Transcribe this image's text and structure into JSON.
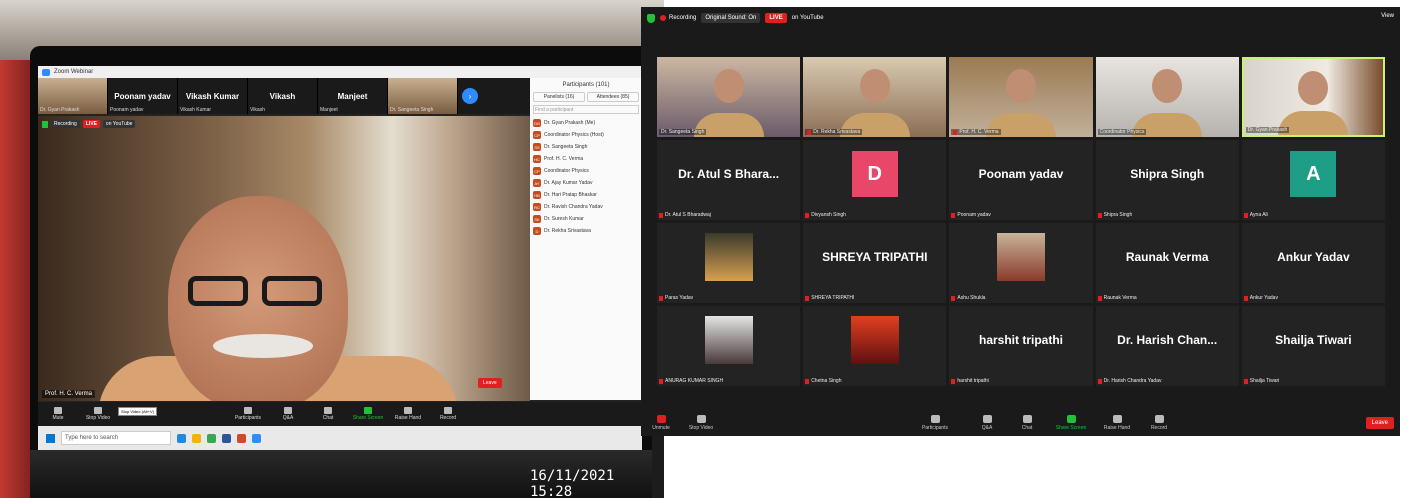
{
  "left_photo": {
    "window_title": "Zoom Webinar",
    "strip": [
      {
        "name": "",
        "sub": "Dr. Gyan Prakash",
        "video": true
      },
      {
        "name": "Poonam yadav",
        "sub": "Poonam yadav",
        "video": false
      },
      {
        "name": "Vikash Kumar",
        "sub": "Vikash Kumar",
        "video": false
      },
      {
        "name": "Vikash",
        "sub": "Vikash",
        "video": false
      },
      {
        "name": "Manjeet",
        "sub": "Manjeet",
        "video": false
      },
      {
        "name": "",
        "sub": "Dr. Sangeeta Singh",
        "video": true
      }
    ],
    "recording": "Recording",
    "live": "LIVE",
    "on_youtube": "on YouTube",
    "active_speaker": "Prof. H. C. Verma",
    "leave": "Leave",
    "panel": {
      "title": "Participants (101)",
      "tab_panelists": "Panelists (16)",
      "tab_attendees": "Attendees (85)",
      "find_placeholder": "Find a participant",
      "rows": [
        {
          "initials": "DG",
          "name": "Dr. Gyan Prakash (Me)"
        },
        {
          "initials": "CP",
          "name": "Coordinator Physics (Host)"
        },
        {
          "initials": "SS",
          "name": "Dr. Sangeeta Singh"
        },
        {
          "initials": "HC",
          "name": "Prof. H. C. Verma"
        },
        {
          "initials": "CP",
          "name": "Coordinator Physics"
        },
        {
          "initials": "AY",
          "name": "Dr. Ajay Kumar Yadav"
        },
        {
          "initials": "HB",
          "name": "Dr. Hari Pratap Bhaskar"
        },
        {
          "initials": "RC",
          "name": "Dr. Ravish Chandra Yadav"
        },
        {
          "initials": "SK",
          "name": "Dr. Suresh Kumar"
        },
        {
          "initials": "D",
          "name": "Dr. Rekha Srivastava"
        }
      ]
    },
    "controls": {
      "mute": "Mute",
      "stop_video": "Stop Video",
      "participants": "Participants",
      "participants_count": "101",
      "qa": "Q&A",
      "chat": "Chat",
      "share": "Share Screen",
      "raise": "Raise Hand",
      "record": "Record",
      "tooltip": "Stop Video (Alt+V)"
    },
    "taskbar_search": "Type here to search",
    "timestamp": "16/11/2021 15:28"
  },
  "zoom": {
    "recording": "Recording",
    "original_sound": "Original Sound: On",
    "live": "LIVE",
    "on_youtube": "on YouTube",
    "view": "View",
    "tiles": [
      {
        "type": "video",
        "cls": "vid1",
        "label": "Dr. Sangeeta Singh",
        "muted": false
      },
      {
        "type": "video",
        "cls": "vid2",
        "label": "Dr. Rekha Srivastava",
        "muted": true
      },
      {
        "type": "video",
        "cls": "vid3",
        "label": "Prof. H. C. Verma",
        "muted": true
      },
      {
        "type": "video",
        "cls": "vid4",
        "label": "Coordinator Physics",
        "muted": false
      },
      {
        "type": "video",
        "cls": "vid5",
        "label": "Dr. Gyan Prakash",
        "muted": false,
        "active": true
      },
      {
        "type": "name",
        "big": "Dr. Atul S Bhara...",
        "label": "Dr. Atul S Bharadwaj"
      },
      {
        "type": "letter",
        "letter": "D",
        "color": "#e8476a",
        "label": "Divyansh Singh"
      },
      {
        "type": "name",
        "big": "Poonam yadav",
        "label": "Poonam yadav"
      },
      {
        "type": "name",
        "big": "Shipra Singh",
        "label": "Shipra Singh"
      },
      {
        "type": "letter",
        "letter": "A",
        "color": "#1e9e87",
        "label": "Ayna Ali"
      },
      {
        "type": "pic",
        "pic": "sunset-photo",
        "colors": [
          "#3a3a2a",
          "#d8a050"
        ],
        "label": "Paras Yadav"
      },
      {
        "type": "name",
        "big": "SHREYA TRIPATHI",
        "label": "SHREYA TRIPATHI"
      },
      {
        "type": "pic",
        "pic": "portrait-photo",
        "colors": [
          "#c9b39a",
          "#8a3b2a"
        ],
        "label": "Ashu Shukla"
      },
      {
        "type": "name",
        "big": "Raunak Verma",
        "label": "Raunak Verma"
      },
      {
        "type": "name",
        "big": "Ankur Yadav",
        "label": "Ankur Yadav"
      },
      {
        "type": "pic",
        "pic": "selfie-photo",
        "colors": [
          "#e4e4e4",
          "#4a3a3a"
        ],
        "label": "ANURAG KUMAR SINGH"
      },
      {
        "type": "pic",
        "pic": "red-sky-photo",
        "colors": [
          "#e04020",
          "#601010"
        ],
        "label": "Chetna Singh"
      },
      {
        "type": "name",
        "big": "harshit tripathi",
        "label": "harshit tripathi"
      },
      {
        "type": "name",
        "big": "Dr. Harish Chan...",
        "label": "Dr. Harish Chandra Yadav"
      },
      {
        "type": "name",
        "big": "Shailja Tiwari",
        "label": "Shailja Tiwari"
      }
    ],
    "controls": {
      "unmute": "Unmute",
      "stop_video": "Stop Video",
      "participants": "Participants",
      "participants_count": "69",
      "qa": "Q&A",
      "chat": "Chat",
      "share": "Share Screen",
      "raise": "Raise Hand",
      "record": "Record",
      "leave": "Leave"
    },
    "accent_share": "#23c13a",
    "accent_leave": "#e02020"
  }
}
